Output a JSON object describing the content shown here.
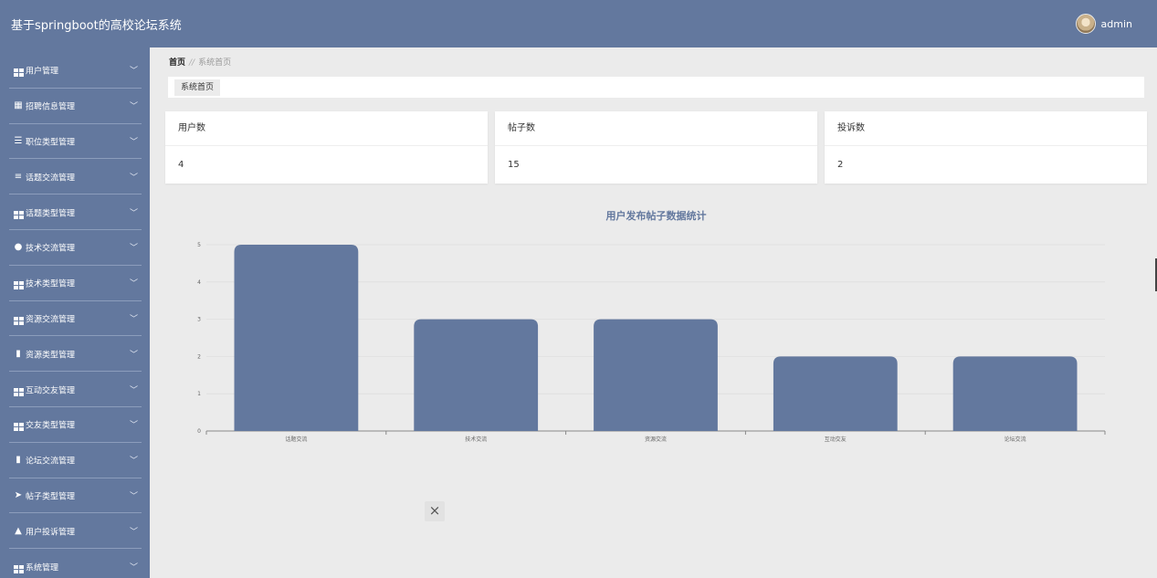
{
  "app": {
    "title": "基于springboot的高校论坛系统"
  },
  "user": {
    "name": "admin"
  },
  "sidebar": {
    "items": [
      {
        "label": "用户管理",
        "icon": "grid-icon"
      },
      {
        "label": "招聘信息管理",
        "icon": "table-icon"
      },
      {
        "label": "职位类型管理",
        "icon": "sliders-icon"
      },
      {
        "label": "话题交流管理",
        "icon": "list-icon"
      },
      {
        "label": "话题类型管理",
        "icon": "grid-icon"
      },
      {
        "label": "技术交流管理",
        "icon": "user-icon"
      },
      {
        "label": "技术类型管理",
        "icon": "grid-icon"
      },
      {
        "label": "资源交流管理",
        "icon": "grid-icon"
      },
      {
        "label": "资源类型管理",
        "icon": "bookmark-icon"
      },
      {
        "label": "互动交友管理",
        "icon": "grid-icon"
      },
      {
        "label": "交友类型管理",
        "icon": "grid-icon"
      },
      {
        "label": "论坛交流管理",
        "icon": "bar-chart-icon"
      },
      {
        "label": "帖子类型管理",
        "icon": "paper-plane-icon"
      },
      {
        "label": "用户投诉管理",
        "icon": "thumbs-up-icon"
      },
      {
        "label": "系统管理",
        "icon": "grid-icon"
      }
    ]
  },
  "breadcrumb": {
    "home": "首页",
    "separator": "//",
    "current": "系统首页"
  },
  "tabs": [
    {
      "label": "系统首页"
    }
  ],
  "stats": [
    {
      "title": "用户数",
      "value": "4"
    },
    {
      "title": "帖子数",
      "value": "15"
    },
    {
      "title": "投诉数",
      "value": "2"
    }
  ],
  "close_button": {
    "symbol": "×"
  },
  "colors": {
    "primary": "#63789e",
    "background": "#ebebeb",
    "bar": "#63789e",
    "title": "#63789e"
  },
  "chart_data": {
    "type": "bar",
    "title": "用户发布帖子数据统计",
    "categories": [
      "话题交流",
      "技术交流",
      "资源交流",
      "互动交友",
      "论坛交流"
    ],
    "values": [
      5,
      3,
      3,
      2,
      2
    ],
    "ylim": [
      0,
      5
    ],
    "yticks": [
      0,
      1,
      2,
      3,
      4,
      5
    ],
    "grid": true,
    "legend": "none"
  }
}
